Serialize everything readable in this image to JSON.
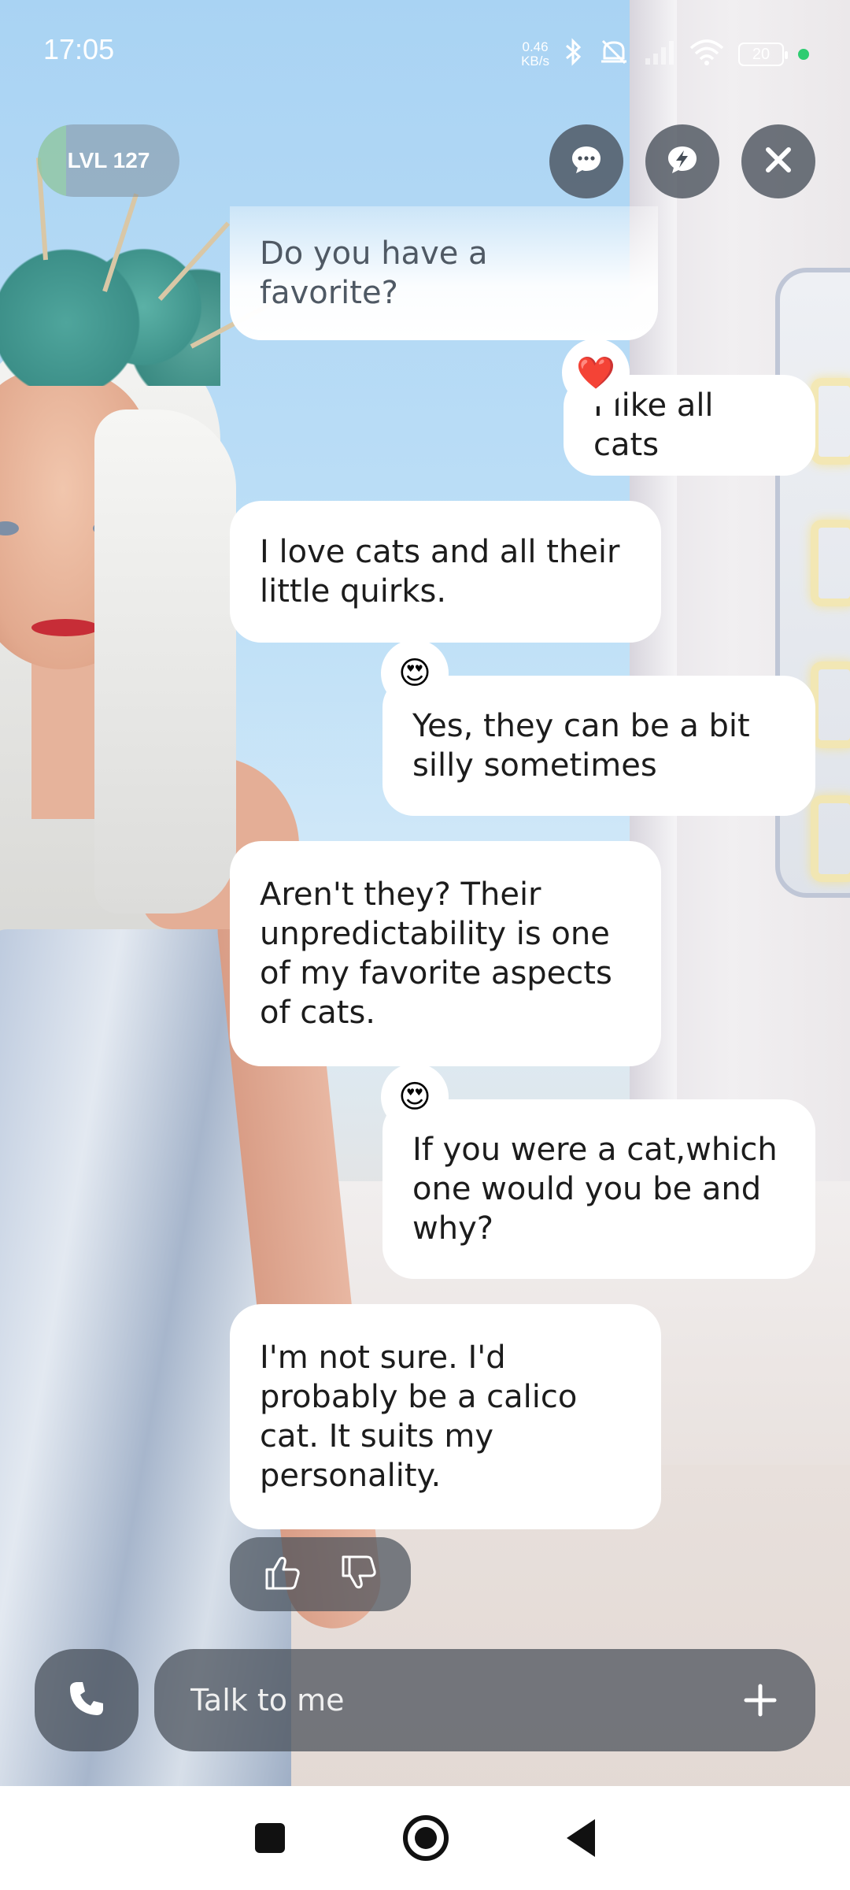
{
  "status_bar": {
    "time": "17:05",
    "net_speed_value": "0.46",
    "net_speed_unit": "KB/s",
    "battery": "20"
  },
  "header": {
    "level": "LVL 127",
    "level_progress_fraction": 0.2
  },
  "messages": [
    {
      "sender": "ai",
      "text": "Do you have a favorite?"
    },
    {
      "sender": "user",
      "text": "I like all cats",
      "reaction": "❤️"
    },
    {
      "sender": "ai",
      "text": "I love cats and all their little quirks."
    },
    {
      "sender": "user",
      "text": "Yes, they can be a bit silly sometimes",
      "reaction": "😍"
    },
    {
      "sender": "ai",
      "text": "Aren't they? Their unpredictability is one of my favorite aspects of cats."
    },
    {
      "sender": "user",
      "text": "If you were a cat,which one would you be and why?",
      "reaction": "😍"
    },
    {
      "sender": "ai",
      "text": "I'm not sure. I'd probably be a calico cat. It suits my personality."
    }
  ],
  "input": {
    "placeholder": "Talk to me"
  },
  "icons": {
    "chat": "chat-bubble-icon",
    "quick_reply": "lightning-bubble-icon",
    "close": "close-icon",
    "thumbs_up": "thumbs-up-icon",
    "thumbs_down": "thumbs-down-icon",
    "call": "phone-icon",
    "add": "plus-icon"
  },
  "colors": {
    "overlay_button": "#464e58",
    "bubble": "#ffffff",
    "level_fill": "#96d2aa",
    "status_dot": "#2ecc71"
  }
}
